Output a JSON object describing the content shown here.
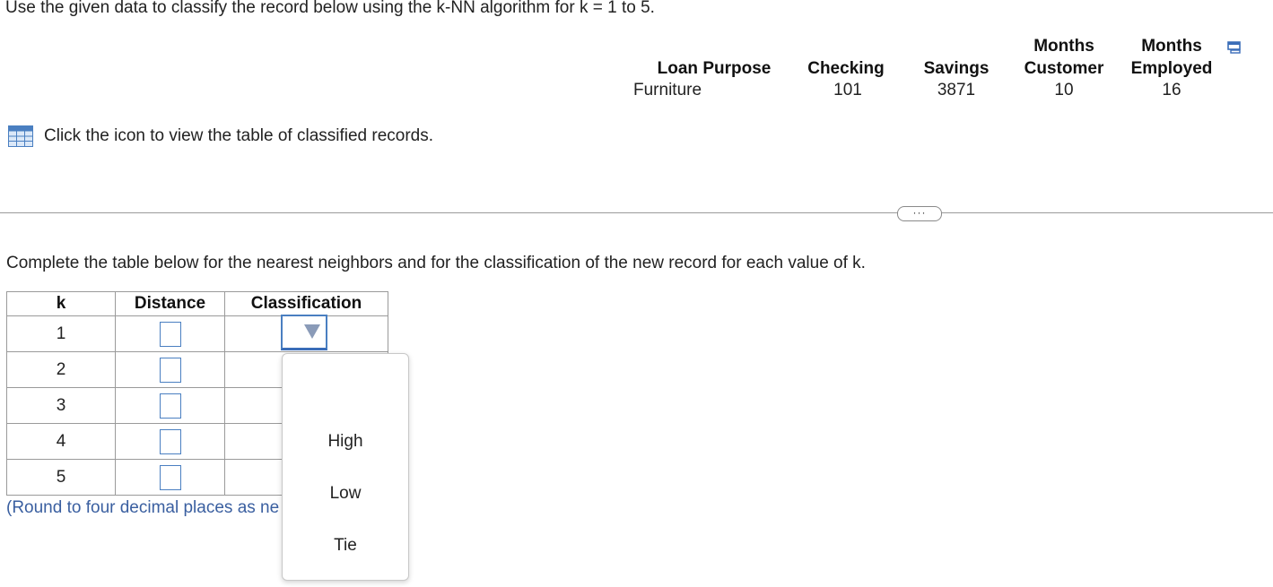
{
  "question": {
    "prompt": "Use the given data to classify the record below using the k-NN algorithm for k = 1 to 5.",
    "instruction": "Complete the table below for the nearest neighbors and for the classification of the new record for each value of k.",
    "click_text": "Click the icon to view the table of classified records.",
    "round_note": "(Round to four decimal places as ne",
    "more_label": "···"
  },
  "record": {
    "headers": {
      "loan_purpose": [
        "",
        "Loan Purpose"
      ],
      "checking": [
        "",
        "Checking"
      ],
      "savings": [
        "",
        "Savings"
      ],
      "months_customer": [
        "Months",
        "Customer"
      ],
      "months_employed": [
        "Months",
        "Employed"
      ]
    },
    "values": {
      "loan_purpose": "Furniture",
      "checking": "101",
      "savings": "3871",
      "months_customer": "10",
      "months_employed": "16"
    }
  },
  "answer_table": {
    "headers": {
      "k": "k",
      "distance": "Distance",
      "classification": "Classification"
    },
    "rows": [
      {
        "k": "1"
      },
      {
        "k": "2"
      },
      {
        "k": "3"
      },
      {
        "k": "4"
      },
      {
        "k": "5"
      }
    ]
  },
  "dropdown": {
    "options": [
      "High",
      "Low",
      "Tie"
    ]
  },
  "colors": {
    "accent": "#4a7fc1",
    "round_note": "#3a5fa0"
  },
  "icons": [
    "table-grid-icon",
    "copy-icon",
    "dropdown-arrow-icon"
  ]
}
